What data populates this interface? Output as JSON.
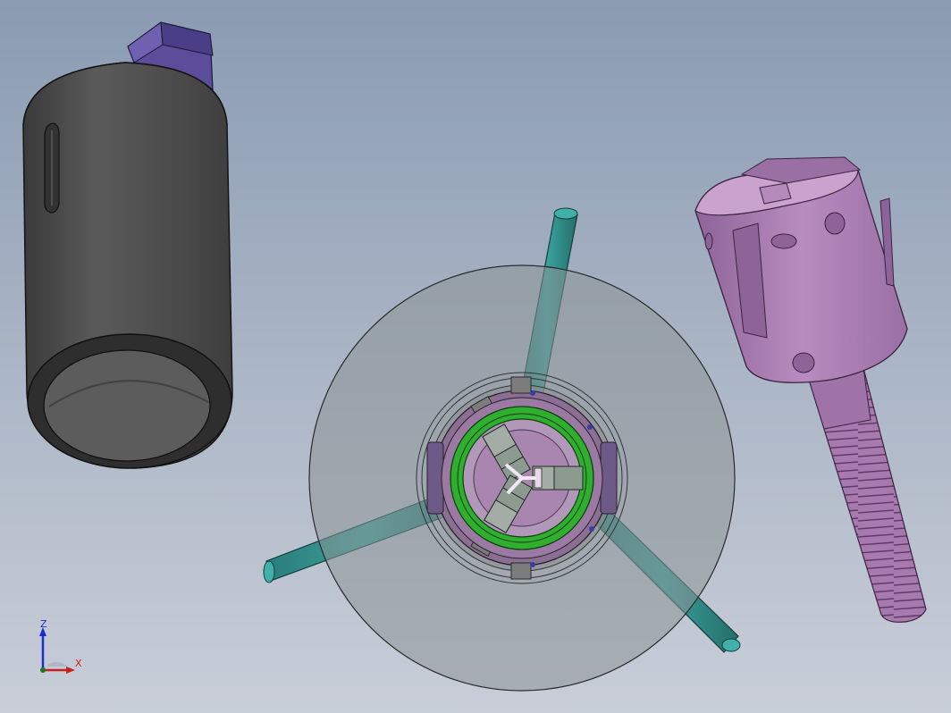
{
  "viewport": {
    "background_top": "#8a9bb2",
    "background_bottom": "#c9ced8"
  },
  "parts": {
    "sleeve": {
      "color": "#4a4a4a"
    },
    "sleeve_key": {
      "color": "#5b4d9a"
    },
    "screw_head": {
      "color": "#a97db0"
    },
    "screw_thread": {
      "color": "#9d6fa8"
    },
    "handle_bars": {
      "color": "#2e8a86"
    },
    "disc": {
      "color": "#8d9496"
    },
    "chuck_body": {
      "color": "#8a6f92"
    },
    "chuck_ring": {
      "color": "#2fae2f"
    },
    "jaws": {
      "color": "#8c9a90"
    }
  },
  "triad": {
    "z_label": "Z",
    "x_label": "X",
    "z_color": "#1b2fc8",
    "x_color": "#c8201b"
  }
}
